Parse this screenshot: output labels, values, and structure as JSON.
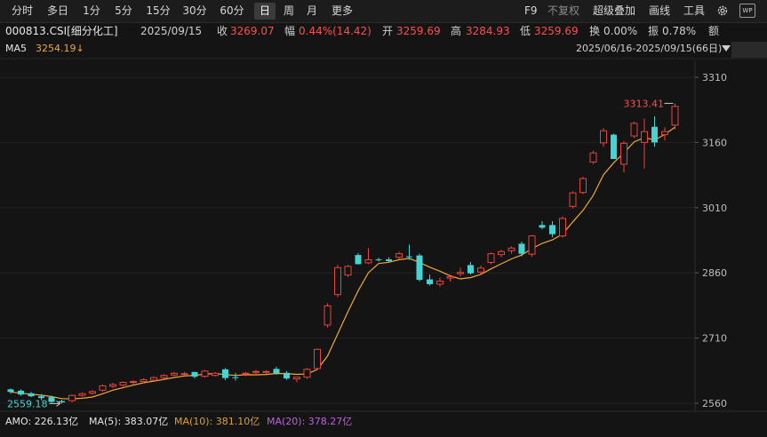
{
  "toolbar": {
    "tabs": [
      "分时",
      "多日",
      "1分",
      "5分",
      "15分",
      "30分",
      "60分",
      "日",
      "周",
      "月",
      "更多"
    ],
    "active_tab": "日",
    "right": [
      "F9",
      "不复权",
      "超级叠加",
      "画线",
      "工具"
    ],
    "wp_label": "WP"
  },
  "quote": {
    "code": "000813.CSI[细分化工]",
    "date": "2025/09/15",
    "close_label": "收",
    "close": "3269.07",
    "change_label": "幅",
    "change": "0.44%(14.42)",
    "open_label": "开",
    "open": "3259.69",
    "high_label": "高",
    "high": "3284.93",
    "low_label": "低",
    "low": "3259.69",
    "turnover_label": "换",
    "turnover": "0.00%",
    "amplitude_label": "振",
    "amplitude": "0.78%",
    "amount_label": "额"
  },
  "ma": {
    "label": "MA5",
    "value": "3254.19↓"
  },
  "range": "2025/06/16-2025/09/15(66日)",
  "volume": {
    "amo": "AMO: 226.13亿",
    "ma5": "MA(5): 383.07亿",
    "ma10": "MA(10): 381.10亿",
    "ma20": "MA(20): 378.27亿"
  },
  "colors": {
    "up": "#e8433c",
    "down": "#46d3d3",
    "ma5": "#f0a63a",
    "ma10": "#e0a030",
    "ma20": "#c060e0",
    "bg": "#141414"
  },
  "chart_data": {
    "type": "candlestick",
    "ylim": [
      2540,
      3340
    ],
    "yticks": [
      3310,
      3160,
      3010,
      2860,
      2710,
      2560
    ],
    "annotations": {
      "max_label": "3313.41",
      "min_label": "2559.18"
    },
    "series": [
      {
        "name": "K",
        "ohlc": [
          [
            2592,
            2594,
            2582,
            2586
          ],
          [
            2589,
            2592,
            2577,
            2580
          ],
          [
            2583,
            2586,
            2574,
            2576
          ],
          [
            2576,
            2581,
            2567,
            2572
          ],
          [
            2574,
            2577,
            2561,
            2563
          ],
          [
            2565,
            2568,
            2559.18,
            2562
          ],
          [
            2566,
            2580,
            2562,
            2578
          ],
          [
            2578,
            2585,
            2575,
            2582
          ],
          [
            2583,
            2590,
            2580,
            2587
          ],
          [
            2590,
            2603,
            2586,
            2600
          ],
          [
            2599,
            2607,
            2595,
            2603
          ],
          [
            2602,
            2610,
            2598,
            2608
          ],
          [
            2608,
            2613,
            2603,
            2610
          ],
          [
            2610,
            2617,
            2606,
            2614
          ],
          [
            2613,
            2622,
            2610,
            2619
          ],
          [
            2619,
            2627,
            2615,
            2624
          ],
          [
            2625,
            2632,
            2622,
            2629
          ],
          [
            2626,
            2632,
            2623,
            2628
          ],
          [
            2632,
            2630,
            2617,
            2621
          ],
          [
            2622,
            2637,
            2619,
            2634
          ],
          [
            2624,
            2632,
            2621,
            2629
          ],
          [
            2638,
            2641,
            2613,
            2618
          ],
          [
            2620,
            2630,
            2612,
            2618
          ],
          [
            2627,
            2632,
            2622,
            2629
          ],
          [
            2631,
            2637,
            2626,
            2633
          ],
          [
            2632,
            2636,
            2628,
            2633
          ],
          [
            2639,
            2644,
            2626,
            2629
          ],
          [
            2630,
            2634,
            2614,
            2617
          ],
          [
            2616,
            2620,
            2608,
            2620
          ],
          [
            2620,
            2641,
            2616,
            2638
          ],
          [
            2640,
            2686,
            2636,
            2684
          ],
          [
            2740,
            2790,
            2734,
            2784
          ],
          [
            2810,
            2878,
            2804,
            2872
          ],
          [
            2855,
            2878,
            2850,
            2875
          ],
          [
            2901,
            2905,
            2879,
            2880
          ],
          [
            2883,
            2917,
            2880,
            2890
          ],
          [
            2891,
            2895,
            2886,
            2890
          ],
          [
            2891,
            2896,
            2884,
            2887
          ],
          [
            2896,
            2909,
            2891,
            2904
          ],
          [
            2898,
            2925,
            2890,
            2896
          ],
          [
            2900,
            2904,
            2840,
            2844
          ],
          [
            2845,
            2856,
            2831,
            2834
          ],
          [
            2834,
            2849,
            2828,
            2841
          ],
          [
            2848,
            2856,
            2840,
            2851
          ],
          [
            2858,
            2872,
            2852,
            2861
          ],
          [
            2878,
            2885,
            2856,
            2859
          ],
          [
            2862,
            2877,
            2857,
            2871
          ],
          [
            2884,
            2907,
            2880,
            2904
          ],
          [
            2902,
            2913,
            2896,
            2909
          ],
          [
            2911,
            2921,
            2904,
            2917
          ],
          [
            2927,
            2932,
            2898,
            2904
          ],
          [
            2903,
            2947,
            2897,
            2945
          ],
          [
            2970,
            2979,
            2960,
            2964
          ],
          [
            2970,
            2979,
            2942,
            2949
          ],
          [
            2945,
            2990,
            2941,
            2985
          ],
          [
            3013,
            3048,
            3008,
            3044
          ],
          [
            3045,
            3081,
            3041,
            3077
          ],
          [
            3115,
            3141,
            3110,
            3136
          ],
          [
            3159,
            3193,
            3150,
            3187
          ],
          [
            3178,
            3180,
            3122,
            3122
          ],
          [
            3110,
            3163,
            3091,
            3158
          ],
          [
            3175,
            3208,
            3170,
            3204
          ],
          [
            3160,
            3215,
            3100,
            3185
          ],
          [
            3196,
            3220,
            3150,
            3160
          ],
          [
            3178,
            3195,
            3165,
            3185
          ],
          [
            3200,
            3250,
            3190,
            3243
          ]
        ]
      }
    ]
  }
}
